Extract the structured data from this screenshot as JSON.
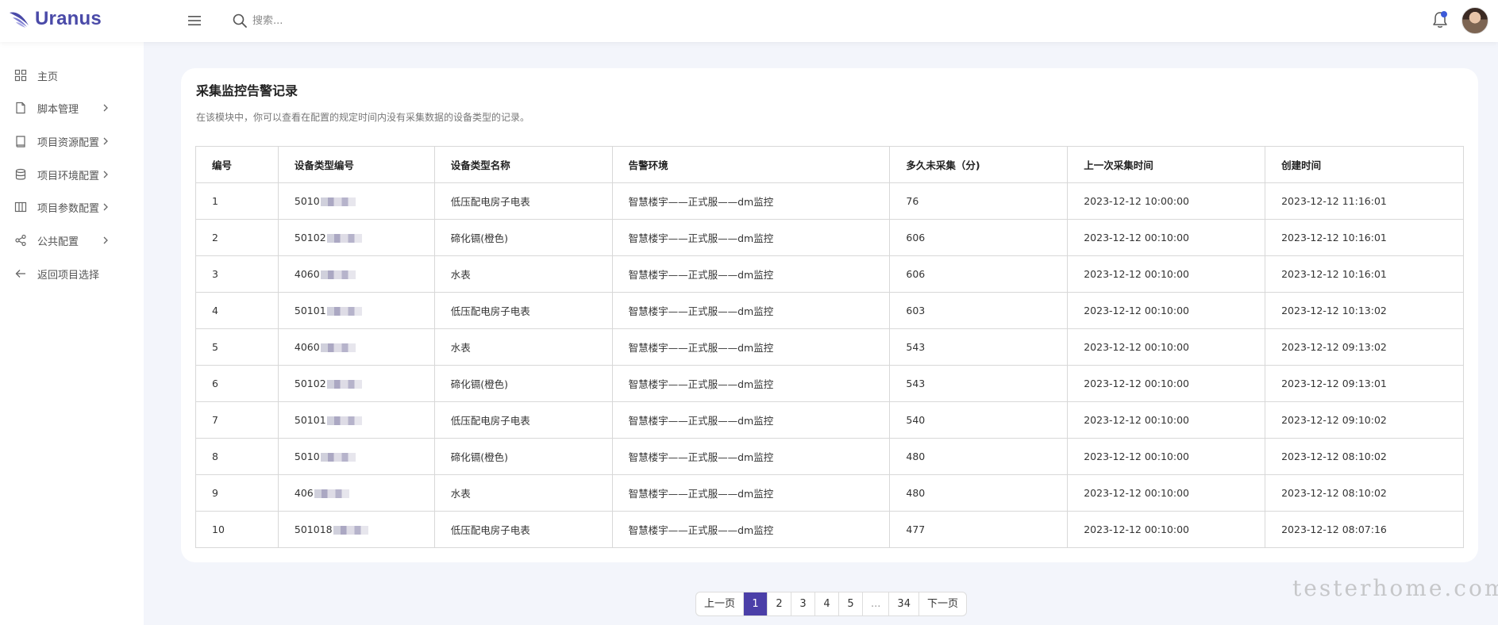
{
  "app": {
    "name": "Uranus",
    "brand_color": "#4a4aa8",
    "accent_color": "#4b3fa8"
  },
  "header": {
    "search_placeholder": "搜索...",
    "menu_icon": "hamburger-icon",
    "search_icon": "search-icon",
    "bell_icon": "bell-icon",
    "has_notification": true
  },
  "sidebar": {
    "items": [
      {
        "label": "主页",
        "icon": "grid-icon",
        "has_children": false
      },
      {
        "label": "脚本管理",
        "icon": "file-icon",
        "has_children": true
      },
      {
        "label": "项目资源配置",
        "icon": "book-icon",
        "has_children": true
      },
      {
        "label": "项目环境配置",
        "icon": "database-icon",
        "has_children": true
      },
      {
        "label": "项目参数配置",
        "icon": "columns-icon",
        "has_children": true
      },
      {
        "label": "公共配置",
        "icon": "share-icon",
        "has_children": true
      },
      {
        "label": "返回项目选择",
        "icon": "arrow-left-icon",
        "has_children": false
      }
    ]
  },
  "main": {
    "title": "采集监控告警记录",
    "description": "在该模块中，你可以查看在配置的规定时间内没有采集数据的设备类型的记录。",
    "table": {
      "columns": [
        "编号",
        "设备类型编号",
        "设备类型名称",
        "告警环境",
        "多久未采集（分)",
        "上一次采集时间",
        "创建时间"
      ],
      "rows": [
        [
          "1",
          "5010",
          "低压配电房子电表",
          "智慧楼宇——正式服——dm监控",
          "76",
          "2023-12-12 10:00:00",
          "2023-12-12 11:16:01"
        ],
        [
          "2",
          "50102",
          "碲化镉(橙色)",
          "智慧楼宇——正式服——dm监控",
          "606",
          "2023-12-12 00:10:00",
          "2023-12-12 10:16:01"
        ],
        [
          "3",
          "4060",
          "水表",
          "智慧楼宇——正式服——dm监控",
          "606",
          "2023-12-12 00:10:00",
          "2023-12-12 10:16:01"
        ],
        [
          "4",
          "50101",
          "低压配电房子电表",
          "智慧楼宇——正式服——dm监控",
          "603",
          "2023-12-12 00:10:00",
          "2023-12-12 10:13:02"
        ],
        [
          "5",
          "4060",
          "水表",
          "智慧楼宇——正式服——dm监控",
          "543",
          "2023-12-12 00:10:00",
          "2023-12-12 09:13:02"
        ],
        [
          "6",
          "50102",
          "碲化镉(橙色)",
          "智慧楼宇——正式服——dm监控",
          "543",
          "2023-12-12 00:10:00",
          "2023-12-12 09:13:01"
        ],
        [
          "7",
          "50101",
          "低压配电房子电表",
          "智慧楼宇——正式服——dm监控",
          "540",
          "2023-12-12 00:10:00",
          "2023-12-12 09:10:02"
        ],
        [
          "8",
          "5010",
          "碲化镉(橙色)",
          "智慧楼宇——正式服——dm监控",
          "480",
          "2023-12-12 00:10:00",
          "2023-12-12 08:10:02"
        ],
        [
          "9",
          "406",
          "水表",
          "智慧楼宇——正式服——dm监控",
          "480",
          "2023-12-12 00:10:00",
          "2023-12-12 08:10:02"
        ],
        [
          "10",
          "501018",
          "低压配电房子电表",
          "智慧楼宇——正式服——dm监控",
          "477",
          "2023-12-12 00:10:00",
          "2023-12-12 08:07:16"
        ]
      ]
    }
  },
  "pagination": {
    "prev_label": "上一页",
    "next_label": "下一页",
    "pages": [
      "1",
      "2",
      "3",
      "4",
      "5",
      "...",
      "34"
    ],
    "current": "1"
  },
  "watermark": "testerhome.com"
}
